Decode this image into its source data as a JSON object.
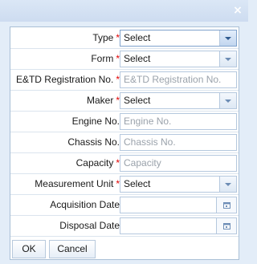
{
  "dialog": {
    "close_glyph": "×"
  },
  "form": {
    "rows": [
      {
        "label": "Type",
        "required": "*",
        "value": "Select"
      },
      {
        "label": "Form",
        "required": "*",
        "value": "Select"
      },
      {
        "label": "E&TD Registration No.",
        "required": "*",
        "placeholder": "E&TD Registration No."
      },
      {
        "label": "Maker",
        "required": "*",
        "value": "Select"
      },
      {
        "label": "Engine No.",
        "placeholder": "Engine No."
      },
      {
        "label": "Chassis No.",
        "placeholder": "Chassis No."
      },
      {
        "label": "Capacity",
        "required": "*",
        "placeholder": "Capacity"
      },
      {
        "label": "Measurement Unit",
        "required": "*",
        "value": "Select"
      },
      {
        "label": "Acquisition Date",
        "value": ""
      },
      {
        "label": "Disposal Date",
        "value": ""
      }
    ]
  },
  "buttons": {
    "ok": "OK",
    "cancel": "Cancel"
  },
  "colors": {
    "required_marker": "#e00000",
    "background": "#e3edf8",
    "border": "#a9bfd6"
  }
}
